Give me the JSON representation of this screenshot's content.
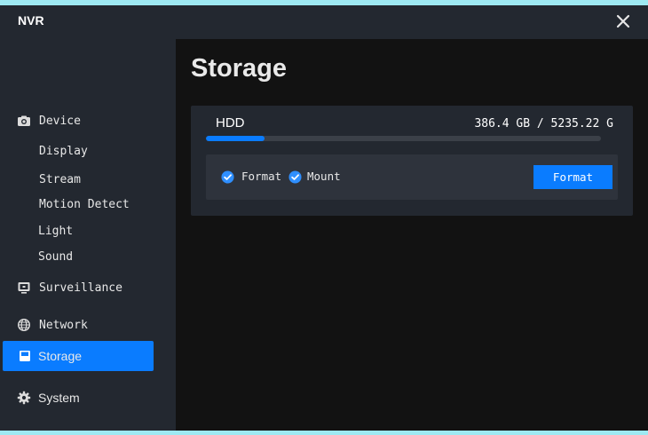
{
  "window": {
    "title": "NVR",
    "close_glyph": "✕"
  },
  "sidebar": {
    "device": {
      "label": "Device",
      "icon": "camera-icon"
    },
    "sub_items": [
      "Display",
      "Stream",
      "Motion Detect",
      "Light",
      "Sound"
    ],
    "surveillance": {
      "label": "Surveillance",
      "icon": "monitor-icon"
    },
    "network": {
      "label": "Network",
      "icon": "globe-icon"
    },
    "storage": {
      "label": "Storage",
      "icon": "floppy-disk-icon"
    },
    "system": {
      "label": "System",
      "icon": "gear-icon"
    },
    "active_item": "Storage"
  },
  "page": {
    "title": "Storage"
  },
  "disk": {
    "name": "HDD",
    "usage": "386.4 GB / 5235.22 G",
    "used_fraction": 0.1476,
    "options": {
      "format_checkbox_label": "Format",
      "format_checked": true,
      "mount_checkbox_label": "Mount",
      "mount_checked": true
    },
    "format_button_label": "Format"
  },
  "colors": {
    "accent": "#0a7cff",
    "background": "#121212",
    "panel": "#232830",
    "frame": "#9ee9f2"
  }
}
